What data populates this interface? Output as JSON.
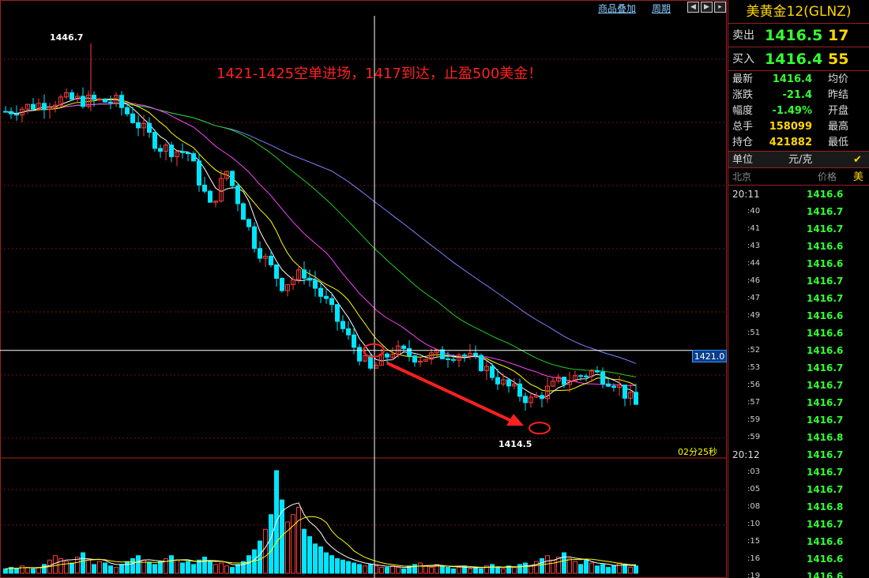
{
  "toolbar": {
    "link1": "商品叠加",
    "link2": "周期",
    "btn_back": "◀",
    "btn_fwd": "▶",
    "btn_sep": "▸"
  },
  "chart": {
    "high_label": "1446.7",
    "low_label": "1414.5",
    "crosshair_price": "1421.0",
    "countdown": "02分25秒",
    "annotation": "1421-1425空单进场，1417到达，止盈500美金！",
    "colors": {
      "up": "#ff3b3b",
      "down": "#00e5ff",
      "ma5": "#ffffff",
      "ma10": "#ffff00",
      "ma20": "#ff40ff",
      "ma40": "#20d020",
      "ma60": "#8080ff",
      "grid": "#7a1010",
      "arrow": "#ff2020"
    }
  },
  "chart_data": {
    "type": "candlestick",
    "instrument": "美黄金12(GLNZ)",
    "ylim": [
      1412,
      1449
    ],
    "highest": 1446.7,
    "lowest": 1414.5,
    "crosshair": 1421.0,
    "volume_series": [
      3,
      4,
      3,
      5,
      4,
      3,
      4,
      6,
      9,
      12,
      10,
      8,
      7,
      11,
      14,
      9,
      6,
      8,
      7,
      5,
      4,
      6,
      8,
      10,
      12,
      9,
      7,
      6,
      8,
      10,
      12,
      9,
      7,
      8,
      6,
      9,
      11,
      8,
      6,
      7,
      5,
      4,
      6,
      8,
      12,
      16,
      22,
      30,
      40,
      70,
      50,
      35,
      40,
      45,
      30,
      25,
      20,
      18,
      14,
      12,
      10,
      9,
      8,
      7,
      6,
      5,
      6,
      5,
      4,
      4,
      5,
      4,
      3,
      5,
      6,
      7,
      5,
      4,
      6,
      5,
      4,
      3,
      4,
      5,
      3,
      4,
      3,
      5,
      6,
      4,
      3,
      5,
      4,
      6,
      7,
      5,
      8,
      10,
      12,
      9,
      11,
      14,
      10,
      8,
      6,
      9,
      7,
      5,
      6,
      4,
      5,
      7,
      6,
      4,
      5,
      6,
      5,
      4,
      3,
      5
    ]
  },
  "side": {
    "title": "美黄金12(GLNZ)",
    "sell_label": "卖出",
    "sell_price": "1416.5",
    "sell_vol": "17",
    "buy_label": "买入",
    "buy_price": "1416.4",
    "buy_vol": "55",
    "stats": [
      {
        "label": "最新",
        "value": "1416.4",
        "label2": "均价"
      },
      {
        "label": "涨跌",
        "value": "-21.4",
        "label2": "昨结"
      },
      {
        "label": "幅度",
        "value": "-1.49%",
        "label2": "开盘"
      },
      {
        "label": "总手",
        "value": "158099",
        "label2": "最高"
      },
      {
        "label": "持仓",
        "value": "421882",
        "label2": "最低"
      }
    ],
    "unit_label": "单位",
    "unit_value": "元/克",
    "unit_check": "✔ 美",
    "hdr_left": "北京",
    "hdr_right": "价格",
    "ticks": [
      {
        "t": "20:11",
        "main": true,
        "p": "1416.6"
      },
      {
        "t": ":40",
        "p": "1416.7"
      },
      {
        "t": ":41",
        "p": "1416.7"
      },
      {
        "t": ":43",
        "p": "1416.6"
      },
      {
        "t": ":44",
        "p": "1416.6"
      },
      {
        "t": ":46",
        "p": "1416.7"
      },
      {
        "t": ":47",
        "p": "1416.7"
      },
      {
        "t": ":49",
        "p": "1416.6"
      },
      {
        "t": ":51",
        "p": "1416.6"
      },
      {
        "t": ":52",
        "p": "1416.6"
      },
      {
        "t": ":53",
        "p": "1416.7"
      },
      {
        "t": ":56",
        "p": "1416.7"
      },
      {
        "t": ":57",
        "p": "1416.7"
      },
      {
        "t": ":59",
        "p": "1416.7"
      },
      {
        "t": ":59",
        "p": "1416.8"
      },
      {
        "t": "20:12",
        "main": true,
        "p": "1416.7"
      },
      {
        "t": ":03",
        "p": "1416.7"
      },
      {
        "t": ":05",
        "p": "1416.7"
      },
      {
        "t": ":08",
        "p": "1416.8"
      },
      {
        "t": ":10",
        "p": "1416.7"
      },
      {
        "t": ":15",
        "p": "1416.6"
      },
      {
        "t": ":16",
        "p": "1416.6"
      },
      {
        "t": ":19",
        "p": "1416.6"
      }
    ]
  }
}
